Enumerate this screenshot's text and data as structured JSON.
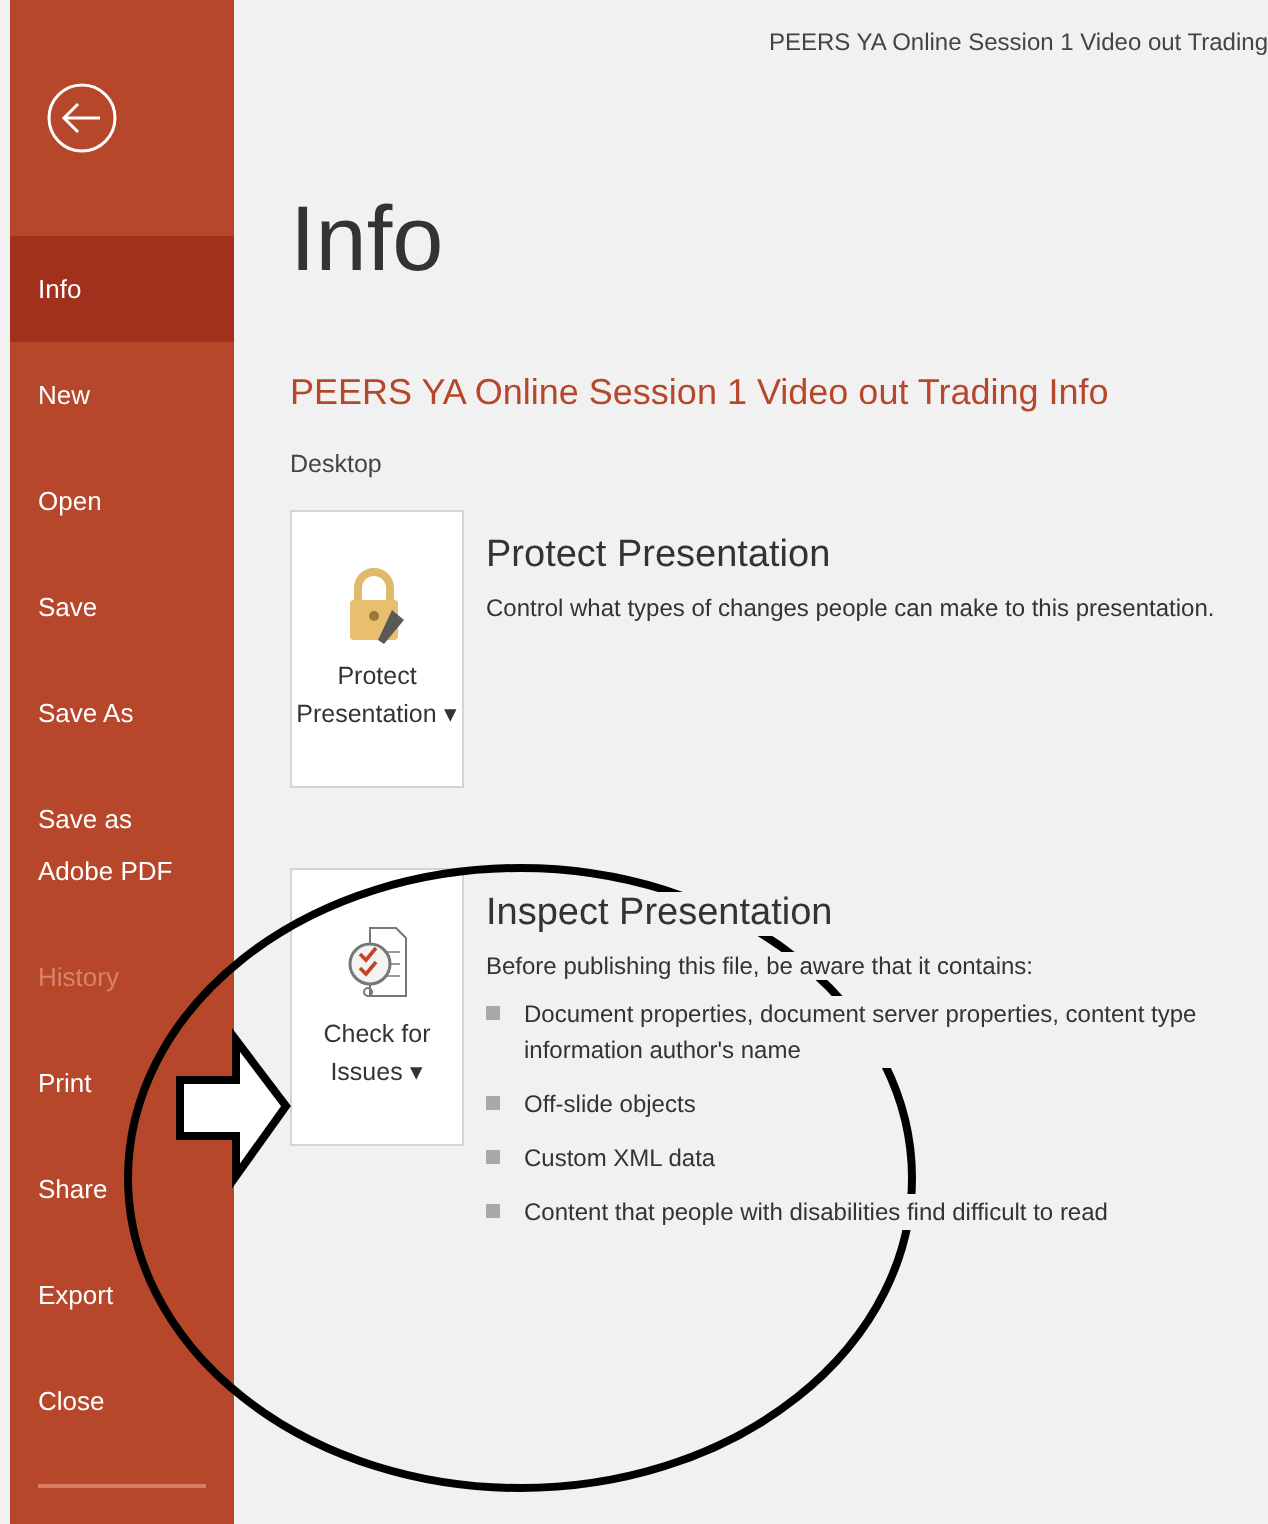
{
  "window": {
    "title": "PEERS YA Online Session 1 Video out Trading"
  },
  "sidebar": {
    "items": [
      {
        "label": "Info",
        "selected": true,
        "disabled": false
      },
      {
        "label": "New",
        "selected": false,
        "disabled": false
      },
      {
        "label": "Open",
        "selected": false,
        "disabled": false
      },
      {
        "label": "Save",
        "selected": false,
        "disabled": false
      },
      {
        "label": "Save As",
        "selected": false,
        "disabled": false
      },
      {
        "label": "Save as Adobe PDF",
        "selected": false,
        "disabled": false
      },
      {
        "label": "History",
        "selected": false,
        "disabled": true
      },
      {
        "label": "Print",
        "selected": false,
        "disabled": false
      },
      {
        "label": "Share",
        "selected": false,
        "disabled": false
      },
      {
        "label": "Export",
        "selected": false,
        "disabled": false
      },
      {
        "label": "Close",
        "selected": false,
        "disabled": false
      }
    ]
  },
  "page": {
    "heading": "Info",
    "document_title": "PEERS YA Online Session 1 Video out Trading Info",
    "location": "Desktop"
  },
  "sections": [
    {
      "kind": "protect",
      "button_lines": [
        "Protect",
        "Presentation ▾"
      ],
      "title": "Protect Presentation",
      "description": "Control what types of changes people can make to this presentation."
    },
    {
      "kind": "inspect",
      "button_lines": [
        "Check for",
        "Issues ▾"
      ],
      "title": "Inspect Presentation",
      "description": "Before publishing this file, be aware that it contains:",
      "items": [
        "Document properties, document server properties, content type information author's name",
        "Off-slide objects",
        "Custom XML data",
        "Content that people with disabilities find difficult to read"
      ]
    }
  ]
}
